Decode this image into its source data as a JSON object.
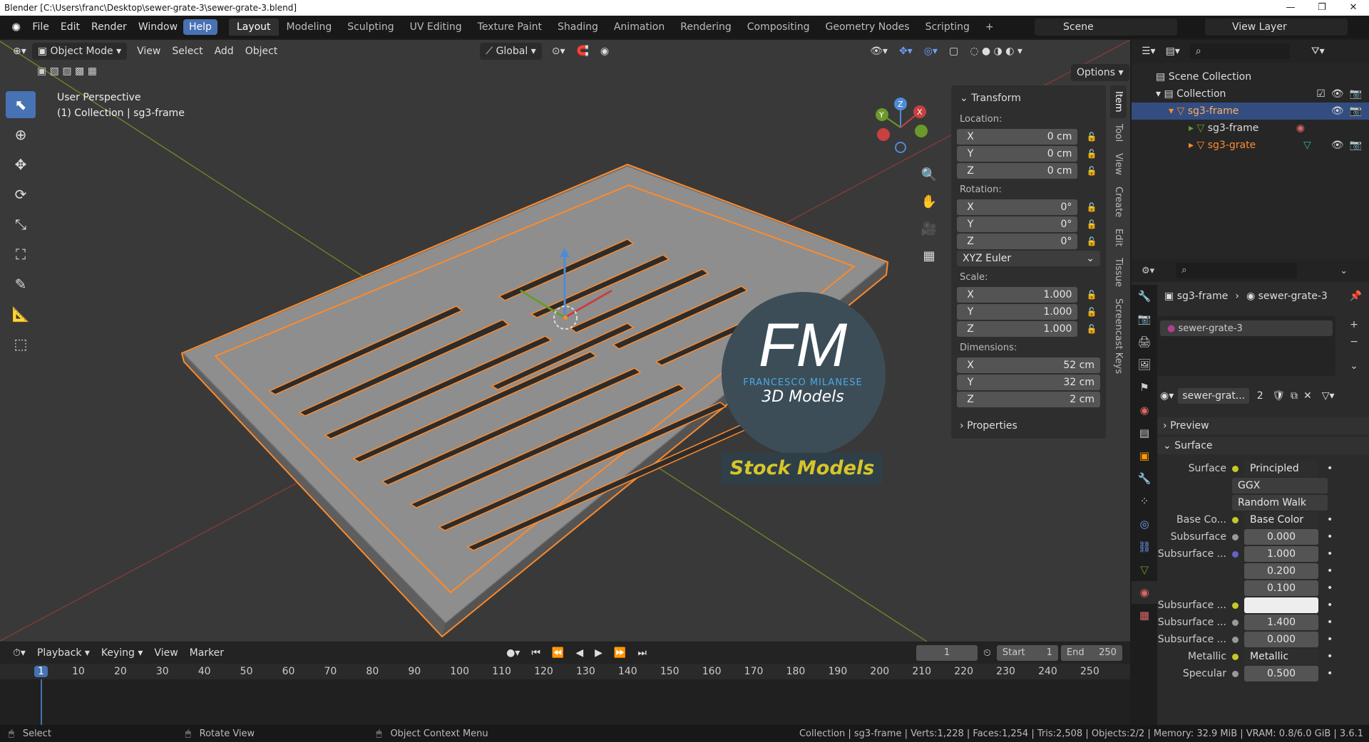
{
  "window": {
    "title": "Blender [C:\\Users\\franc\\Desktop\\sewer-grate-3\\sewer-grate-3.blend]",
    "minimize": "—",
    "maximize": "❐",
    "close": "✕"
  },
  "menu": {
    "items": [
      "File",
      "Edit",
      "Render",
      "Window",
      "Help"
    ],
    "active": "Help"
  },
  "workspaces": {
    "items": [
      "Layout",
      "Modeling",
      "Sculpting",
      "UV Editing",
      "Texture Paint",
      "Shading",
      "Animation",
      "Rendering",
      "Compositing",
      "Geometry Nodes",
      "Scripting"
    ],
    "active": "Layout",
    "add": "+"
  },
  "scene": {
    "label": "Scene",
    "view_layer": "View Layer"
  },
  "viewport": {
    "mode": "Object Mode",
    "menus": [
      "View",
      "Select",
      "Add",
      "Object"
    ],
    "orientation": "Global",
    "options": "Options",
    "perspective": "User Perspective",
    "collection_line": "(1) Collection | sg3-frame",
    "gizmo": {
      "x": "X",
      "y": "Y",
      "z": "Z"
    }
  },
  "toolbar": {
    "tools": [
      "select-box",
      "cursor",
      "move",
      "rotate",
      "scale",
      "transform",
      "annotate",
      "measure",
      "add-cube"
    ],
    "active": "select-box"
  },
  "npanel": {
    "transform_title": "Transform",
    "location_label": "Location:",
    "location": [
      {
        "axis": "X",
        "value": "0 cm"
      },
      {
        "axis": "Y",
        "value": "0 cm"
      },
      {
        "axis": "Z",
        "value": "0 cm"
      }
    ],
    "rotation_label": "Rotation:",
    "rotation": [
      {
        "axis": "X",
        "value": "0°"
      },
      {
        "axis": "Y",
        "value": "0°"
      },
      {
        "axis": "Z",
        "value": "0°"
      }
    ],
    "rotation_mode": "XYZ Euler",
    "scale_label": "Scale:",
    "scale": [
      {
        "axis": "X",
        "value": "1.000"
      },
      {
        "axis": "Y",
        "value": "1.000"
      },
      {
        "axis": "Z",
        "value": "1.000"
      }
    ],
    "dimensions_label": "Dimensions:",
    "dimensions": [
      {
        "axis": "X",
        "value": "52 cm"
      },
      {
        "axis": "Y",
        "value": "32 cm"
      },
      {
        "axis": "Z",
        "value": "2 cm"
      }
    ],
    "properties_title": "Properties",
    "tabs": [
      "Item",
      "Tool",
      "View",
      "Create",
      "Edit",
      "Tissue",
      "Screencast Keys"
    ],
    "active_tab": "Item"
  },
  "watermark": {
    "fm": "FM",
    "name": "FRANCESCO MILANESE",
    "sub": "3D Models",
    "stock": "Stock Models"
  },
  "outliner": {
    "scene_collection": "Scene Collection",
    "collection": "Collection",
    "rows": [
      {
        "name": "sg3-frame",
        "selected": true
      },
      {
        "name": "sg3-frame",
        "selected": false
      },
      {
        "name": "sg3-grate",
        "selected": false
      }
    ]
  },
  "properties": {
    "breadcrumb_object": "sg3-frame",
    "breadcrumb_material": "sewer-grate-3",
    "slot": "sewer-grate-3",
    "material_name": "sewer-grat...",
    "users": "2",
    "preview": "Preview",
    "surface_section": "Surface",
    "rows": [
      {
        "label": "Surface",
        "value": "Principled BSDF",
        "kind": "link"
      },
      {
        "label": "",
        "value": "GGX",
        "kind": "dropdown"
      },
      {
        "label": "",
        "value": "Random Walk",
        "kind": "dropdown"
      },
      {
        "label": "Base Co...",
        "value": "Base Color",
        "kind": "link"
      },
      {
        "label": "Subsurface",
        "value": "0.000",
        "kind": "value"
      },
      {
        "label": "Subsurface ...",
        "value": "1.000",
        "kind": "value"
      },
      {
        "label": "",
        "value": "0.200",
        "kind": "value"
      },
      {
        "label": "",
        "value": "0.100",
        "kind": "value"
      },
      {
        "label": "Subsurface ...",
        "value": "",
        "kind": "color"
      },
      {
        "label": "Subsurface ...",
        "value": "1.400",
        "kind": "value"
      },
      {
        "label": "Subsurface ...",
        "value": "0.000",
        "kind": "value"
      },
      {
        "label": "Metallic",
        "value": "Metallic",
        "kind": "link"
      },
      {
        "label": "Specular",
        "value": "0.500",
        "kind": "value"
      }
    ]
  },
  "timeline": {
    "menus": [
      "Playback",
      "Keying",
      "View",
      "Marker"
    ],
    "current_frame": "1",
    "start_label": "Start",
    "start": "1",
    "end_label": "End",
    "end": "250",
    "ticks": [
      "1",
      "10",
      "20",
      "30",
      "40",
      "50",
      "60",
      "70",
      "80",
      "90",
      "100",
      "110",
      "120",
      "130",
      "140",
      "150",
      "160",
      "170",
      "180",
      "190",
      "200",
      "210",
      "220",
      "230",
      "240",
      "250"
    ]
  },
  "statusbar": {
    "select": "Select",
    "rotate": "Rotate View",
    "context": "Object Context Menu",
    "stats": "Collection | sg3-frame | Verts:1,228 | Faces:1,254 | Tris:2,508 | Objects:2/2 | Memory: 32.9 MiB | VRAM: 0.8/6.0 GiB | 3.6.1"
  },
  "colors": {
    "accent": "#4772b3",
    "selected_orange": "#ff8a2a",
    "background": "#393939"
  }
}
